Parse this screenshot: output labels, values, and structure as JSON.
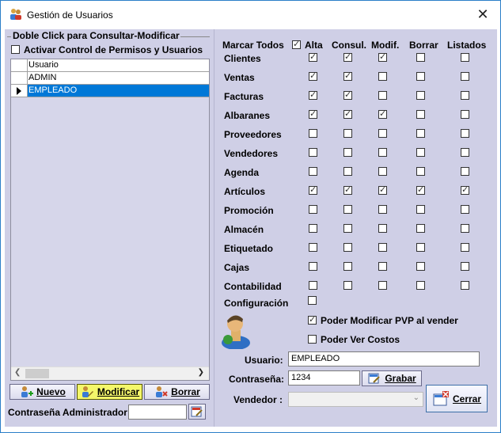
{
  "window": {
    "title": "Gestión de Usuarios",
    "close_symbol": "✕"
  },
  "users_panel": {
    "group_title": "Doble Click para Consultar-Modificar",
    "activate_control_label": "Activar Control de Permisos y Usuarios",
    "activate_control_checked": false,
    "grid": {
      "column_header": "Usuario",
      "rows": [
        "ADMIN",
        "EMPLEADO"
      ],
      "selected_row": 1
    },
    "buttons": {
      "new_label": "Nuevo",
      "modify_label": "Modificar",
      "delete_label": "Borrar"
    },
    "admin_password_label": "Contraseña Administrador:",
    "admin_password_value": ""
  },
  "permissions": {
    "mark_all_label": "Marcar Todos",
    "mark_all_checked": true,
    "columns": [
      "Alta",
      "Consul.",
      "Modif.",
      "Borrar",
      "Listados"
    ],
    "rows": [
      {
        "label": "Clientes",
        "checks": [
          true,
          true,
          true,
          false,
          false
        ]
      },
      {
        "label": "Ventas",
        "checks": [
          true,
          true,
          false,
          false,
          false
        ]
      },
      {
        "label": "Facturas",
        "checks": [
          true,
          true,
          false,
          false,
          false
        ]
      },
      {
        "label": "Albaranes",
        "checks": [
          true,
          true,
          true,
          false,
          false
        ]
      },
      {
        "label": "Proveedores",
        "checks": [
          false,
          false,
          false,
          false,
          false
        ]
      },
      {
        "label": "Vendedores",
        "checks": [
          false,
          false,
          false,
          false,
          false
        ]
      },
      {
        "label": "Agenda",
        "checks": [
          false,
          false,
          false,
          false,
          false
        ]
      },
      {
        "label": "Artículos",
        "checks": [
          true,
          true,
          true,
          true,
          true
        ]
      },
      {
        "label": "Promoción",
        "checks": [
          false,
          false,
          false,
          false,
          false
        ]
      },
      {
        "label": "Almacén",
        "checks": [
          false,
          false,
          false,
          false,
          false
        ]
      },
      {
        "label": "Etiquetado",
        "checks": [
          false,
          false,
          false,
          false,
          false
        ]
      },
      {
        "label": "Cajas",
        "checks": [
          false,
          false,
          false,
          false,
          false
        ]
      },
      {
        "label": "Contabilidad",
        "checks": [
          false,
          false,
          false,
          false,
          false
        ]
      }
    ],
    "configuracion_label": "Configuración",
    "configuracion_checked": false,
    "modify_pvp_label": "Poder Modificar PVP al vender",
    "modify_pvp_checked": true,
    "view_costs_label": "Poder Ver Costos",
    "view_costs_checked": false
  },
  "user_form": {
    "user_label": "Usuario:",
    "user_value": "EMPLEADO",
    "password_label": "Contraseña:",
    "password_value": "1234",
    "save_label": "Grabar",
    "seller_label": "Vendedor :",
    "seller_value": "",
    "close_label": "Cerrar"
  },
  "colors": {
    "panel_bg": "#cfcfe6",
    "selection": "#0078d7",
    "active_button": "#f4f76a"
  }
}
